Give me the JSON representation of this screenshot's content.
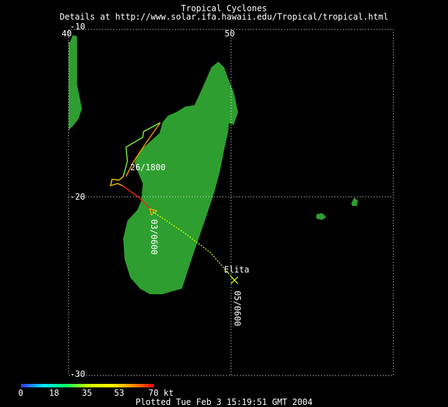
{
  "header": {
    "title": "Tropical Cyclones",
    "details": "Details at http://www.solar.ifa.hawaii.edu/Tropical/tropical.html"
  },
  "map": {
    "lon_labels": [
      "40",
      "50"
    ],
    "lat_labels": [
      "-10",
      "-20",
      "-30"
    ],
    "lon_range": [
      40,
      50
    ],
    "lat_range": [
      -10,
      -30
    ],
    "land_color": "#2e9e30",
    "gridline": "dotted-white"
  },
  "storm": {
    "name": "Elita",
    "time_labels": [
      "26/1800",
      "03/0600",
      "05/0600"
    ],
    "segment_colors": {
      "weak": "#88ff44",
      "moderate": "#ffcc00",
      "mid": "#ff9900",
      "strong": "#ff2200",
      "forecast": "#ccff00"
    }
  },
  "legend": {
    "ticks": [
      "0",
      "18",
      "35",
      "53",
      "70 kt"
    ]
  },
  "footer": {
    "plotted": "Plotted Tue Feb 3 15:19:51 GMT 2004"
  }
}
